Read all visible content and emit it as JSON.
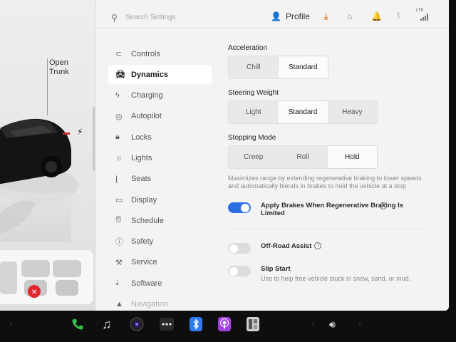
{
  "car_panel": {
    "trunk_label": "Open\nTrunk"
  },
  "search": {
    "placeholder": "Search Settings"
  },
  "profile": {
    "label": "Profile"
  },
  "nav": {
    "items": [
      {
        "label": "Controls",
        "icon": "toggle-icon"
      },
      {
        "label": "Dynamics",
        "icon": "car-icon"
      },
      {
        "label": "Charging",
        "icon": "bolt-icon"
      },
      {
        "label": "Autopilot",
        "icon": "steering-wheel-icon"
      },
      {
        "label": "Locks",
        "icon": "lock-icon"
      },
      {
        "label": "Lights",
        "icon": "sun-icon"
      },
      {
        "label": "Seats",
        "icon": "seat-icon"
      },
      {
        "label": "Display",
        "icon": "display-icon"
      },
      {
        "label": "Schedule",
        "icon": "alarm-clock-icon"
      },
      {
        "label": "Safety",
        "icon": "alert-circle-icon"
      },
      {
        "label": "Service",
        "icon": "wrench-icon"
      },
      {
        "label": "Software",
        "icon": "download-icon"
      },
      {
        "label": "Navigation",
        "icon": "navigation-arrow-icon"
      }
    ],
    "active": "Dynamics"
  },
  "acceleration": {
    "title": "Acceleration",
    "options": [
      "Chill",
      "Standard"
    ],
    "selected": "Standard"
  },
  "steering": {
    "title": "Steering Weight",
    "options": [
      "Light",
      "Standard",
      "Heavy"
    ],
    "selected": "Standard"
  },
  "stopping": {
    "title": "Stopping Mode",
    "options": [
      "Creep",
      "Roll",
      "Hold"
    ],
    "selected": "Hold",
    "description": "Maximizes range by extending regenerative braking to lower speeds and automatically blends in brakes to hold the vehicle at a stop"
  },
  "toggles": {
    "apply_brakes": {
      "label": "Apply Brakes When Regenerative Braking Is Limited",
      "on": true
    },
    "off_road": {
      "label": "Off-Road Assist",
      "on": false
    },
    "slip_start": {
      "label": "Slip Start",
      "description": "Use to help free vehicle stuck in snow, sand, or mud.",
      "on": false
    }
  },
  "status_bar": {
    "lte": "LTE"
  },
  "colors": {
    "accent": "#2c6fe5",
    "download": "#e8832a",
    "phone": "#36c24a",
    "bluetooth": "#2b7bf3",
    "podcasts": "#a33ee0"
  },
  "dock": {
    "icons": [
      "chevron-right-icon",
      "phone-icon",
      "music-icon",
      "camera-icon",
      "more-icon",
      "bluetooth-icon",
      "podcasts-icon",
      "toybox-icon",
      "chevron-left-icon",
      "volume-icon",
      "chevron-right-icon"
    ]
  }
}
